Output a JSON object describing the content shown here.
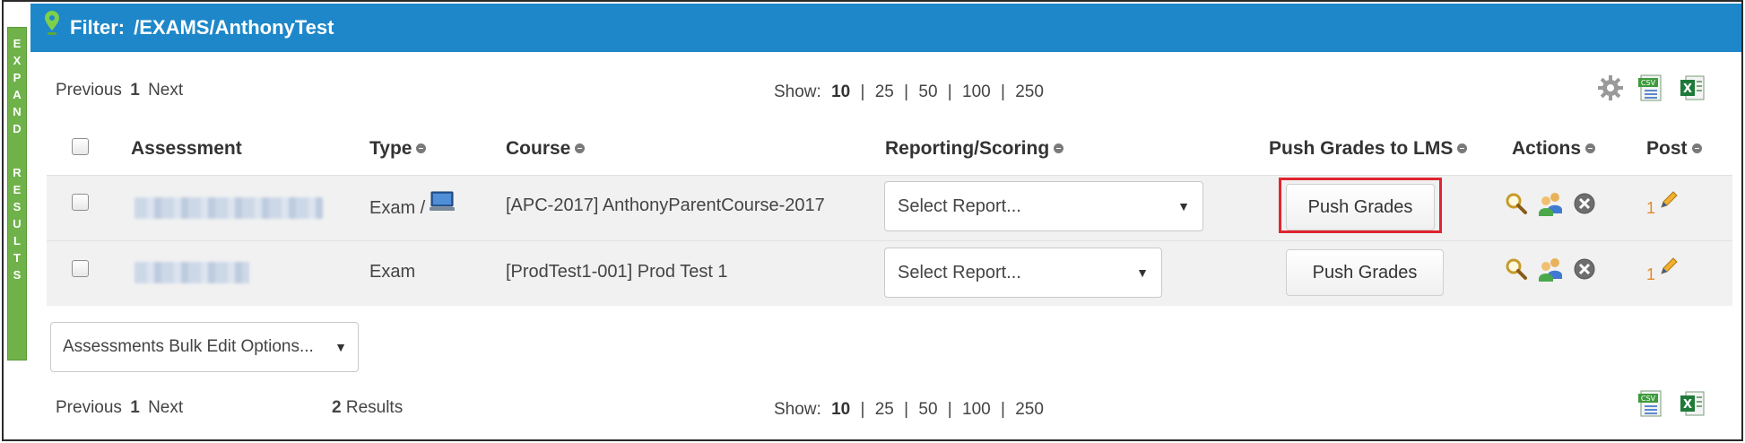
{
  "sidebar_tab": {
    "letters": [
      "E",
      "X",
      "P",
      "A",
      "N",
      "D",
      "R",
      "E",
      "S",
      "U",
      "L",
      "T",
      "S"
    ]
  },
  "filter": {
    "label": "Filter:",
    "path": "/EXAMS/AnthonyTest"
  },
  "pager_top": {
    "previous": "Previous",
    "page": "1",
    "next": "Next"
  },
  "pager_bottom": {
    "previous": "Previous",
    "page": "1",
    "next": "Next",
    "results_count": "2",
    "results_label": "Results"
  },
  "show": {
    "label": "Show:",
    "current": "10",
    "options": [
      "25",
      "50",
      "100",
      "250"
    ],
    "sep": "|"
  },
  "columns": {
    "assessment": "Assessment",
    "type": "Type",
    "course": "Course",
    "reporting": "Reporting/Scoring",
    "push": "Push Grades to LMS",
    "actions": "Actions",
    "post": "Post"
  },
  "rows": [
    {
      "type": "Exam /",
      "course": "[APC-2017] AnthonyParentCourse-2017",
      "report_placeholder": "Select Report...",
      "push_label": "Push Grades",
      "post_count": "1"
    },
    {
      "type": "Exam",
      "course": "[ProdTest1-001] Prod Test 1",
      "report_placeholder": "Select Report...",
      "push_label": "Push Grades",
      "post_count": "1"
    }
  ],
  "bulk_edit": {
    "label": "Assessments Bulk Edit Options..."
  },
  "icons": {
    "settings": "gear-icon",
    "csv": "csv-export-icon",
    "excel": "excel-export-icon",
    "view": "magnifier-icon",
    "users": "users-icon",
    "delete": "delete-circle-icon",
    "edit": "pencil-icon",
    "computer": "computer-icon",
    "location": "map-pin-icon"
  },
  "colors": {
    "header_bar": "#1e87c9",
    "expand_tab": "#6fb24a",
    "highlight": "#e0242f"
  }
}
